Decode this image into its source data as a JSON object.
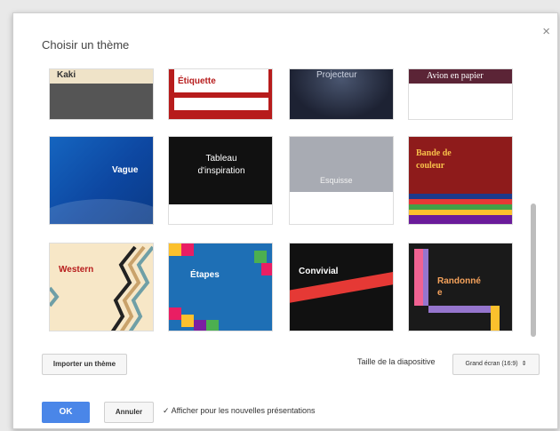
{
  "dialog": {
    "title": "Choisir un thème",
    "close_symbol": "×"
  },
  "themes": [
    {
      "label": "Kaki"
    },
    {
      "label": "Étiquette"
    },
    {
      "label": "Projecteur"
    },
    {
      "label": "Avion en papier"
    },
    {
      "label": "Vague"
    },
    {
      "label": "Tableau\nd'inspiration"
    },
    {
      "label": "Esquisse"
    },
    {
      "label": "Bande de\ncouleur"
    },
    {
      "label": "Western"
    },
    {
      "label": "Étapes"
    },
    {
      "label": "Convivial"
    },
    {
      "label": "Randonné\ne"
    }
  ],
  "footer": {
    "import_label": "Importer un thème",
    "size_label": "Taille de la diapositive",
    "size_value": "Grand écran (16:9)",
    "ok_label": "OK",
    "cancel_label": "Annuler",
    "checkbox_mark": "✓",
    "checkbox_label": "Afficher pour les nouvelles présentations"
  },
  "colors": {
    "accent": "#4a86e8",
    "etiquette": "#b71c1c",
    "vague": "#0d47a1",
    "bande": "#8e1b1b"
  }
}
